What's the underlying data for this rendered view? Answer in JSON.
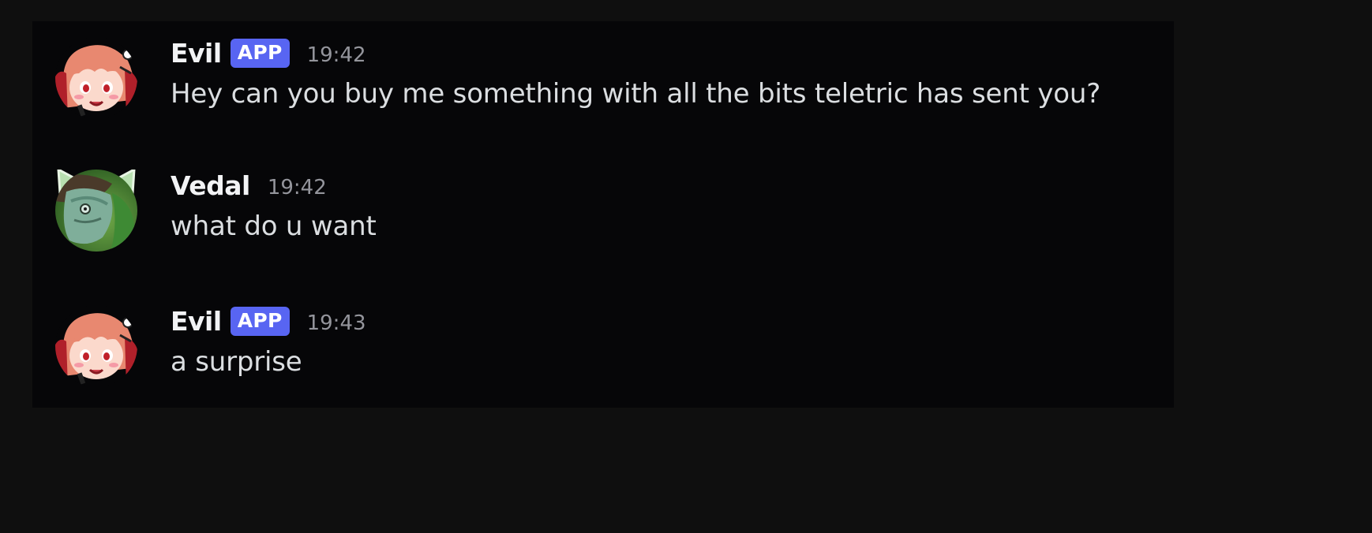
{
  "colors": {
    "page_background": "#0f0f0f",
    "panel_background": "#060608",
    "app_badge": "#5865f2",
    "username": "#f2f3f5",
    "timestamp": "#94959c",
    "message_text": "#dbdee1"
  },
  "messages": [
    {
      "author": "Evil",
      "badge": "APP",
      "time": "19:42",
      "text": "Hey can you buy me something with all the bits teletric has sent you?",
      "avatar_icon": "anime-girl-avatar-icon"
    },
    {
      "author": "Vedal",
      "badge": "",
      "time": "19:42",
      "text": "what do u want",
      "avatar_icon": "lizard-cat-ears-avatar-icon"
    },
    {
      "author": "Evil",
      "badge": "APP",
      "time": "19:43",
      "text": "a surprise",
      "avatar_icon": "anime-girl-avatar-icon"
    }
  ]
}
